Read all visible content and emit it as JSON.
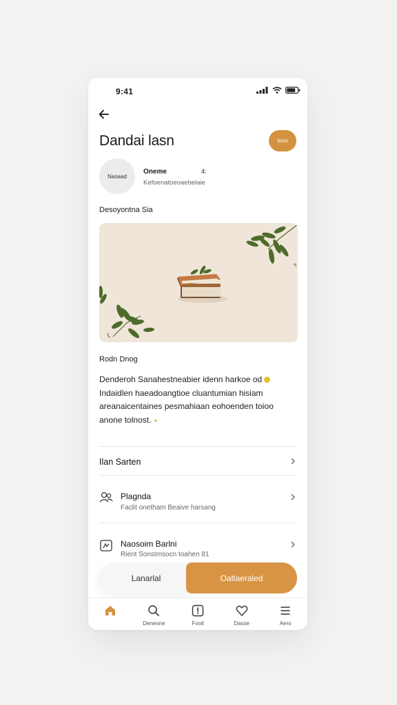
{
  "status": {
    "time": "9:41"
  },
  "header": {
    "title": "Dandai lasn",
    "button_label": "Ioon"
  },
  "profile": {
    "avatar_label": "Naoaad",
    "name": "Oneme",
    "count": "4:",
    "subtitle": "Kefoenatoeoaebelaie"
  },
  "section_title": "Desoyontna Sia",
  "hero": {
    "illustration": "book-with-leaves"
  },
  "details": {
    "heading": "Rodn Dnog",
    "description_lines": [
      "Denderoh Sanahestneabier idenn harkoe od",
      "Indaidlen haeadoangtioe cluantumian hisiam",
      "areanaicentaines pesmahiaan eohoenden toioo",
      "anone tolnost."
    ]
  },
  "list": [
    {
      "title": "Ilan Sarten",
      "subtitle": "",
      "icon": ""
    },
    {
      "title": "Plagnda",
      "subtitle": "Faclit onetham Beaive harsang",
      "icon": "people-icon"
    },
    {
      "title": "Naosoim Barlni",
      "subtitle": "Rient Sonstmsocn toahen 81",
      "icon": "calendar-icon"
    }
  ],
  "actions": {
    "secondary_label": "Lanarlal",
    "primary_label": "Oatlaeraled"
  },
  "tabs": [
    {
      "label": "",
      "icon": "home-icon"
    },
    {
      "label": "Denesne",
      "icon": "search-icon"
    },
    {
      "label": "Fooil",
      "icon": "alert-icon"
    },
    {
      "label": "Dasse",
      "icon": "heart-icon"
    },
    {
      "label": "Aero",
      "icon": "menu-icon"
    }
  ],
  "colors": {
    "accent": "#d89444",
    "hero_bg": "#efe5d8",
    "leaf": "#4d6b2b"
  }
}
